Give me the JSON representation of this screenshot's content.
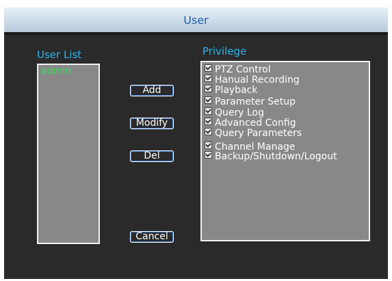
{
  "window": {
    "title": "User"
  },
  "user_list": {
    "label": "User List",
    "items": [
      "admin"
    ]
  },
  "buttons": {
    "add": "Add",
    "modify": "Modify",
    "del": "Del",
    "cancel": "Cancel"
  },
  "privilege": {
    "label": "Privilege",
    "items": [
      {
        "label": "PTZ Control",
        "checked": true
      },
      {
        "label": "Hanual Recording",
        "checked": true
      },
      {
        "label": "Playback",
        "checked": true
      },
      {
        "label": "Parameter Setup",
        "checked": true
      },
      {
        "label": "Query Log",
        "checked": true
      },
      {
        "label": "Advanced Config",
        "checked": true
      },
      {
        "label": "Query Parameters",
        "checked": true
      },
      {
        "label": "Channel Manage",
        "checked": true
      },
      {
        "label": "Backup/Shutdown/Logout",
        "checked": true
      }
    ]
  },
  "colors": {
    "title_text": "#1f5ea8",
    "section_label": "#2ab6f0",
    "selected_user": "#36e05a",
    "panel_bg": "#2a2a2a",
    "list_bg": "#888888"
  }
}
